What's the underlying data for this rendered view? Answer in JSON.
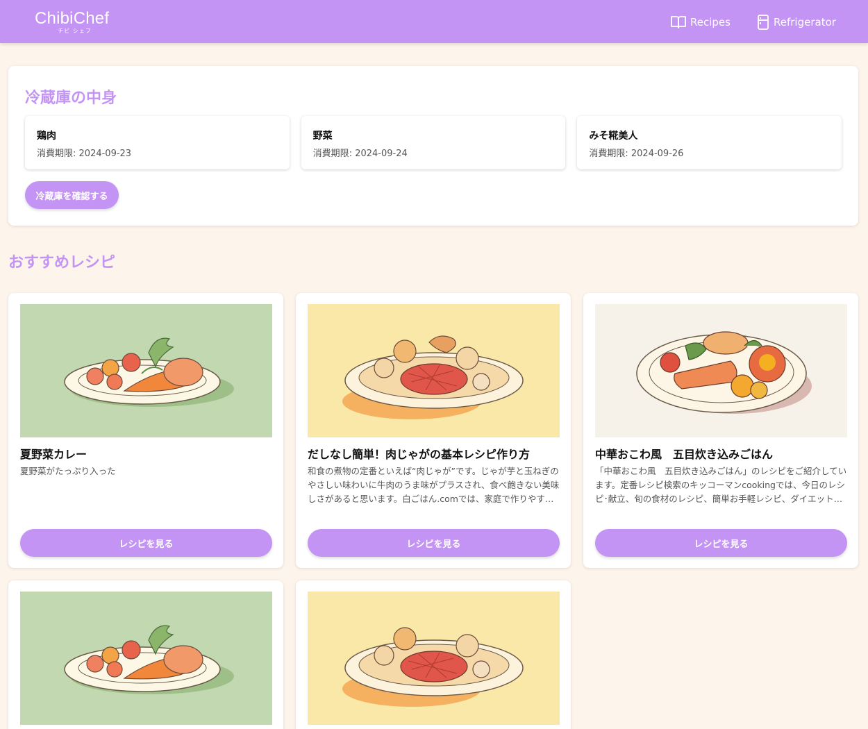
{
  "header": {
    "logo": "ChibiChef",
    "logo_sub": "チビ シェフ",
    "nav": [
      {
        "label": "Recipes",
        "icon": "book-icon"
      },
      {
        "label": "Refrigerator",
        "icon": "fridge-icon"
      }
    ]
  },
  "fridge": {
    "title": "冷蔵庫の中身",
    "expiry_label": "消費期限",
    "items": [
      {
        "name": "鶏肉",
        "expiry": "2024-09-23"
      },
      {
        "name": "野菜",
        "expiry": "2024-09-24"
      },
      {
        "name": "みそ糀美人",
        "expiry": "2024-09-26"
      }
    ],
    "button_label": "冷蔵庫を確認する"
  },
  "recommendations": {
    "title": "おすすめレシピ",
    "button_label": "レシピを見る",
    "recipes": [
      {
        "title": "夏野菜カレー",
        "description": "夏野菜がたっぷり入った",
        "image_bg": "#c2d8b0"
      },
      {
        "title": "だしなし簡単！肉じゃがの基本レシピ作り方",
        "description": "和食の煮物の定番といえば“肉じゃが”です。じゃが芋と玉ねぎのやさしい味わいに牛肉のうま味がプラスされ、食べ飽きない美味しさがあると思います。白ごはん.comでは、家庭で作りやすいように、鍋ひとつで作れる定番の肉じゃがレシピを紹介しています。",
        "image_bg": "#f9e8a8"
      },
      {
        "title": "中華おこわ風　五目炊き込みごはん",
        "description": "「中華おこわ風　五目炊き込みごはん」のレシピをご紹介しています。定番レシピ検索のキッコーマンcookingでは、今日のレシピ･献立、旬の食材のレシピ、簡単お手軽レシピ、ダイエットレシピなどを多数ご紹介しています。",
        "image_bg": "#f6f2ea"
      },
      {
        "title": "",
        "description": "",
        "image_bg": "#c2d8b0"
      },
      {
        "title": "",
        "description": "",
        "image_bg": "#f9e8a8"
      }
    ]
  }
}
